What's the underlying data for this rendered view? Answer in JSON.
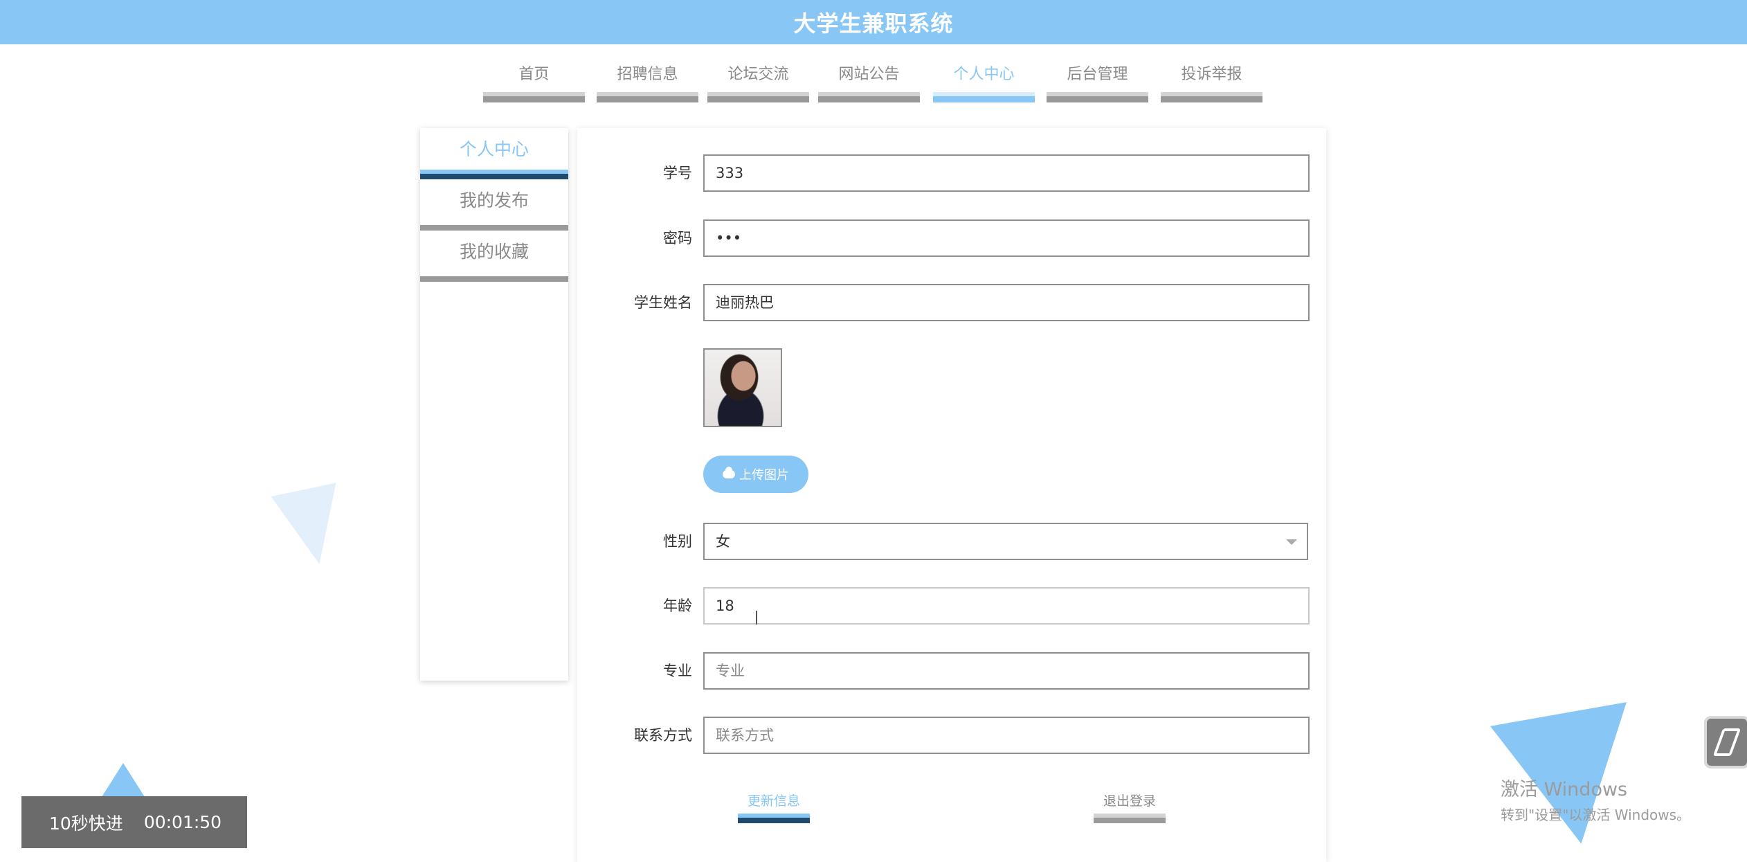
{
  "header": {
    "title": "大学生兼职系统"
  },
  "nav": {
    "items": [
      {
        "label": "首页"
      },
      {
        "label": "招聘信息"
      },
      {
        "label": "论坛交流"
      },
      {
        "label": "网站公告"
      },
      {
        "label": "个人中心"
      },
      {
        "label": "后台管理"
      },
      {
        "label": "投诉举报"
      }
    ],
    "active_index": 4
  },
  "sidebar": {
    "items": [
      {
        "label": "个人中心"
      },
      {
        "label": "我的发布"
      },
      {
        "label": "我的收藏"
      }
    ],
    "active_index": 0
  },
  "form": {
    "student_id": {
      "label": "学号",
      "value": "333"
    },
    "password": {
      "label": "密码",
      "value": "•••"
    },
    "student_name": {
      "label": "学生姓名",
      "value": "迪丽热巴"
    },
    "upload_label": "上传图片",
    "gender": {
      "label": "性别",
      "value": "女"
    },
    "age": {
      "label": "年龄",
      "value": "18"
    },
    "major": {
      "label": "专业",
      "placeholder": "专业"
    },
    "contact": {
      "label": "联系方式",
      "placeholder": "联系方式"
    },
    "update_label": "更新信息",
    "logout_label": "退出登录"
  },
  "player": {
    "skip_label": "10秒快进",
    "time": "00:01:50"
  },
  "watermark": {
    "line1": "激活 Windows",
    "line2": "转到\"设置\"以激活 Windows。"
  },
  "colors": {
    "accent": "#87c6f5",
    "dark_accent": "#1e4b6e",
    "muted": "#8a8a8a"
  }
}
